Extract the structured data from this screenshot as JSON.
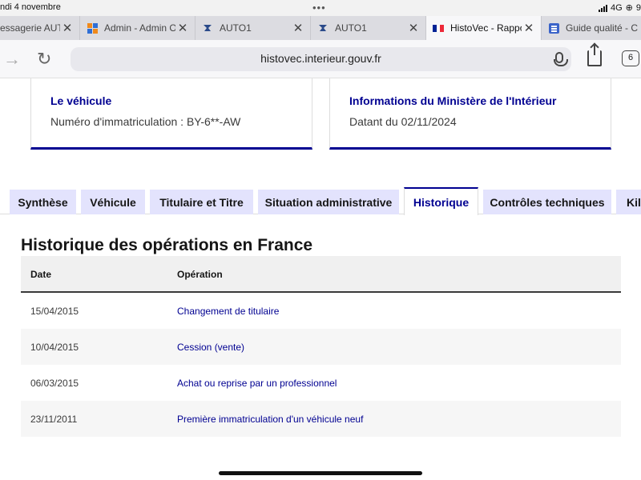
{
  "status_bar": {
    "date": "ndi 4 novembre",
    "network": "4G",
    "battery_partial": "9"
  },
  "browser": {
    "tabs": [
      {
        "title": "essagerie AUTO",
        "favicon": "messaging-icon",
        "active": false
      },
      {
        "title": "Admin - Admin O",
        "favicon": "admin-grid-icon",
        "active": false
      },
      {
        "title": "AUTO1",
        "favicon": "auto1-logo-icon",
        "active": false
      },
      {
        "title": "AUTO1",
        "favicon": "auto1-logo-icon",
        "active": false
      },
      {
        "title": "HistoVec - Rappo",
        "favicon": "french-flag-icon",
        "active": true
      },
      {
        "title": "Guide qualité - C",
        "favicon": "document-icon",
        "active": false
      }
    ],
    "url": "histovec.interieur.gouv.fr",
    "tab_count": "6"
  },
  "cards": {
    "vehicle": {
      "title": "Le véhicule",
      "text": "Numéro d'immatriculation : BY-6**-AW"
    },
    "ministry": {
      "title": "Informations du Ministère de l'Intérieur",
      "text": "Datant du 02/11/2024"
    }
  },
  "page_tabs": [
    {
      "label": "Synthèse",
      "active": false
    },
    {
      "label": "Véhicule",
      "active": false
    },
    {
      "label": "Titulaire et Titre",
      "active": false
    },
    {
      "label": "Situation administrative",
      "active": false
    },
    {
      "label": "Historique",
      "active": true
    },
    {
      "label": "Contrôles techniques",
      "active": false
    },
    {
      "label": "Kilo",
      "active": false
    }
  ],
  "history": {
    "title": "Historique des opérations en France",
    "columns": [
      "Date",
      "Opération"
    ],
    "rows": [
      {
        "date": "15/04/2015",
        "operation": "Changement de titulaire"
      },
      {
        "date": "10/04/2015",
        "operation": "Cession (vente)"
      },
      {
        "date": "06/03/2015",
        "operation": "Achat ou reprise par un professionnel"
      },
      {
        "date": "23/11/2011",
        "operation": "Première immatriculation d'un véhicule neuf"
      }
    ]
  },
  "colors": {
    "primary_blue": "#000091",
    "tab_inactive_bg": "#e3e3fd",
    "table_header_bg": "#f0f0f0"
  }
}
